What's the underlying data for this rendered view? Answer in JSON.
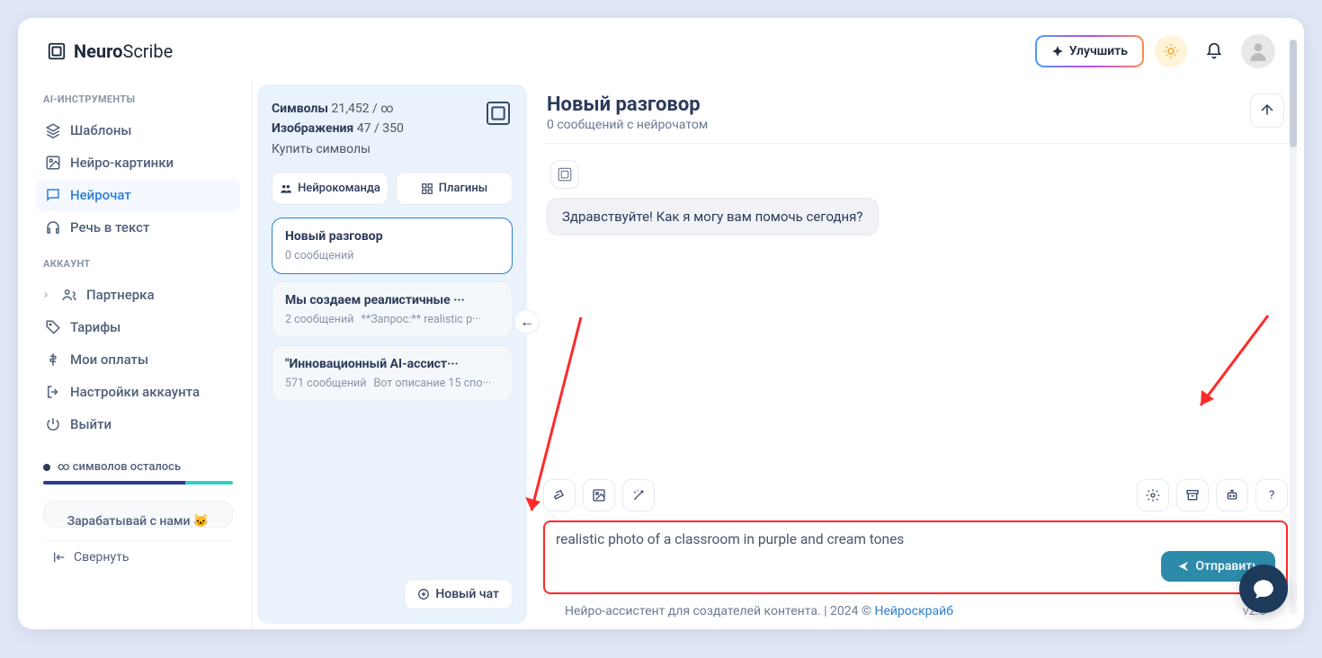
{
  "brand": {
    "name1": "Neuro",
    "name2": "Scribe"
  },
  "header": {
    "upgrade": "Улучшить"
  },
  "sidebar": {
    "section1": "AI-ИНСТРУМЕНТЫ",
    "section2": "АККАУНТ",
    "items": {
      "templates": "Шаблоны",
      "images": "Нейро-картинки",
      "chat": "Нейрочат",
      "speech": "Речь в текст",
      "partner": "Партнерка",
      "tariffs": "Тарифы",
      "payments": "Мои оплаты",
      "settings": "Настройки аккаунта",
      "logout": "Выйти"
    },
    "credits": {
      "label": "∞ символов осталось"
    },
    "earn": "Зарабатывай с нами 🐱",
    "collapse": "Свернуть"
  },
  "mid": {
    "stats": {
      "symbols_label": "Символы",
      "symbols_value": "21,452 / ∞",
      "images_label": "Изображения",
      "images_value": "47 / 350",
      "buy": "Купить символы"
    },
    "tabs": {
      "team": "Нейрокоманда",
      "plugins": "Плагины"
    },
    "conversations": [
      {
        "title": "Новый разговор",
        "sub": "0 сообщений",
        "preview": ""
      },
      {
        "title": "Мы создаем реалистичные ···",
        "sub": "2 сообщений",
        "preview": "**Запрос:** realistic p···"
      },
      {
        "title": "\"Инновационный AI-ассист···",
        "sub": "571 сообщений",
        "preview": "Вот описание 15 спо···"
      }
    ],
    "new_chat": "Новый чат"
  },
  "chat": {
    "title": "Новый разговор",
    "subtitle": "0 сообщений с нейрочатом",
    "greeting": "Здравствуйте! Как я могу вам помочь сегодня?",
    "input_value": "realistic photo of a classroom in purple and cream tones",
    "send": "Отправить",
    "help": "?"
  },
  "footer": {
    "text": "Нейро-ассистент для создателей контента.",
    "year": "| 2024 ©",
    "link": "Нейроскрайб",
    "version": "v2.0"
  }
}
